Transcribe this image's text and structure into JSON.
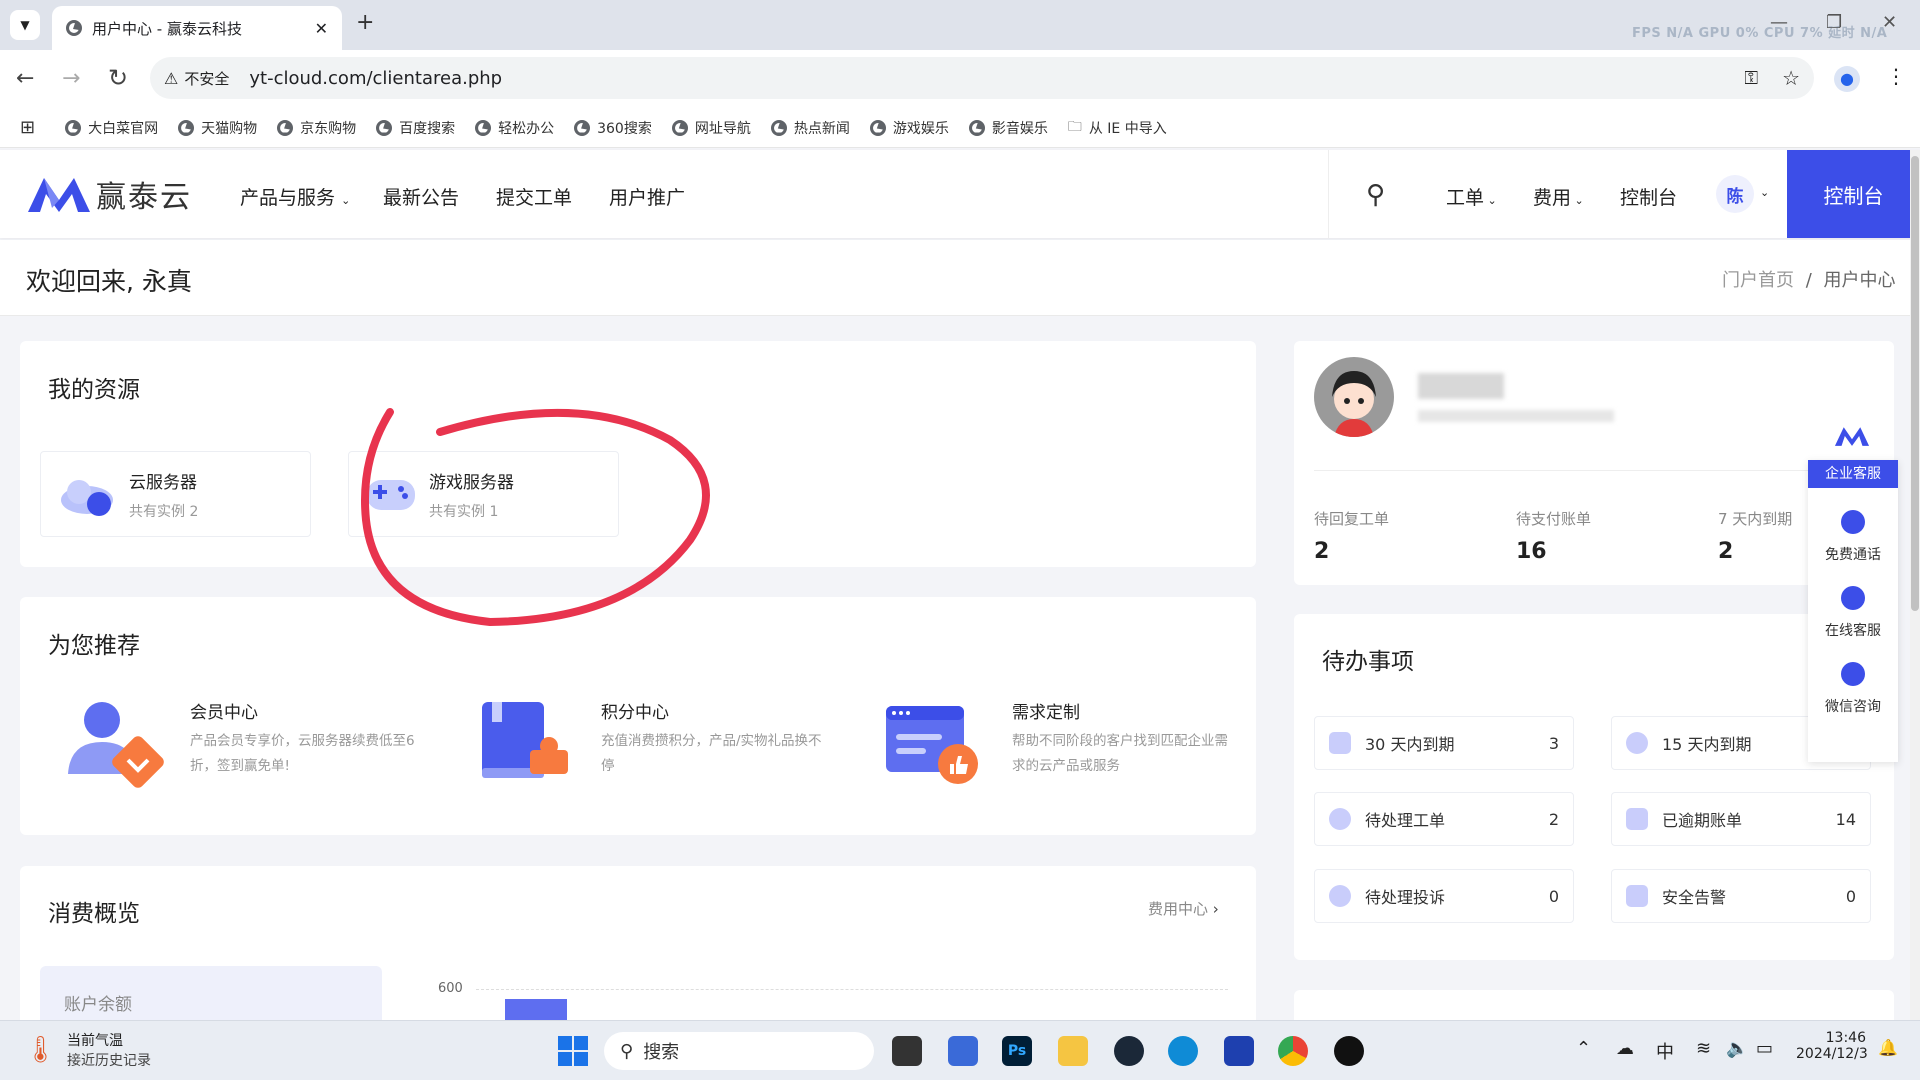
{
  "browser": {
    "tab_title": "用户中心 - 赢泰云科技",
    "perf_overlay": "FPS  N/A  GPU  0%  CPU  7%  延时  N/A",
    "insecure_label": "不安全",
    "url": "yt-cloud.com/clientarea.php",
    "bookmarks": [
      "大白菜官网",
      "天猫购物",
      "京东购物",
      "百度搜索",
      "轻松办公",
      "360搜索",
      "网址导航",
      "热点新闻",
      "游戏娱乐",
      "影音娱乐",
      "从 IE 中导入"
    ]
  },
  "site": {
    "logo_text": "赢泰云",
    "nav": [
      "产品与服务",
      "最新公告",
      "提交工单",
      "用户推广"
    ],
    "right_nav": [
      "工单",
      "费用",
      "控制台"
    ],
    "avatar_char": "陈",
    "console_button": "控制台"
  },
  "welcome": {
    "title": "欢迎回来, 永真",
    "breadcrumb": [
      "门户首页",
      "用户中心"
    ],
    "separator": "/"
  },
  "resources": {
    "title": "我的资源",
    "items": [
      {
        "name": "云服务器",
        "count": "共有实例 2"
      },
      {
        "name": "游戏服务器",
        "count": "共有实例 1"
      }
    ]
  },
  "recommend": {
    "title": "为您推荐",
    "items": [
      {
        "title": "会员中心",
        "desc": "产品会员专享价，云服务器续费低至6折，签到赢免单!"
      },
      {
        "title": "积分中心",
        "desc": "充值消费攒积分，产品/实物礼品换不停"
      },
      {
        "title": "需求定制",
        "desc": "帮助不同阶段的客户找到匹配企业需求的云产品或服务"
      }
    ]
  },
  "consumption": {
    "title": "消费概览",
    "link": "费用中心",
    "balance_label": "账户余额",
    "chart_data": {
      "type": "bar",
      "y_tick_top": 600
    }
  },
  "stats": [
    {
      "label": "待回复工单",
      "value": "2"
    },
    {
      "label": "待支付账单",
      "value": "16"
    },
    {
      "label": "7 天内到期",
      "value": "2"
    }
  ],
  "todo": {
    "title": "待办事项",
    "items": [
      {
        "label": "30 天内到期",
        "count": "3"
      },
      {
        "label": "15 天内到期",
        "count": ""
      },
      {
        "label": "待处理工单",
        "count": "2"
      },
      {
        "label": "已逾期账单",
        "count": "14"
      },
      {
        "label": "待处理投诉",
        "count": "0"
      },
      {
        "label": "安全告警",
        "count": "0"
      }
    ]
  },
  "float_service": {
    "title": "企业客服",
    "items": [
      "免费通话",
      "在线客服",
      "微信咨询"
    ]
  },
  "taskbar": {
    "weather_title": "当前气温",
    "weather_sub": "接近历史记录",
    "search": "搜索",
    "ime": "中",
    "time": "13:46",
    "date": "2024/12/3"
  },
  "colors": {
    "primary": "#3c4ee8",
    "annotation": "#e8344e"
  }
}
